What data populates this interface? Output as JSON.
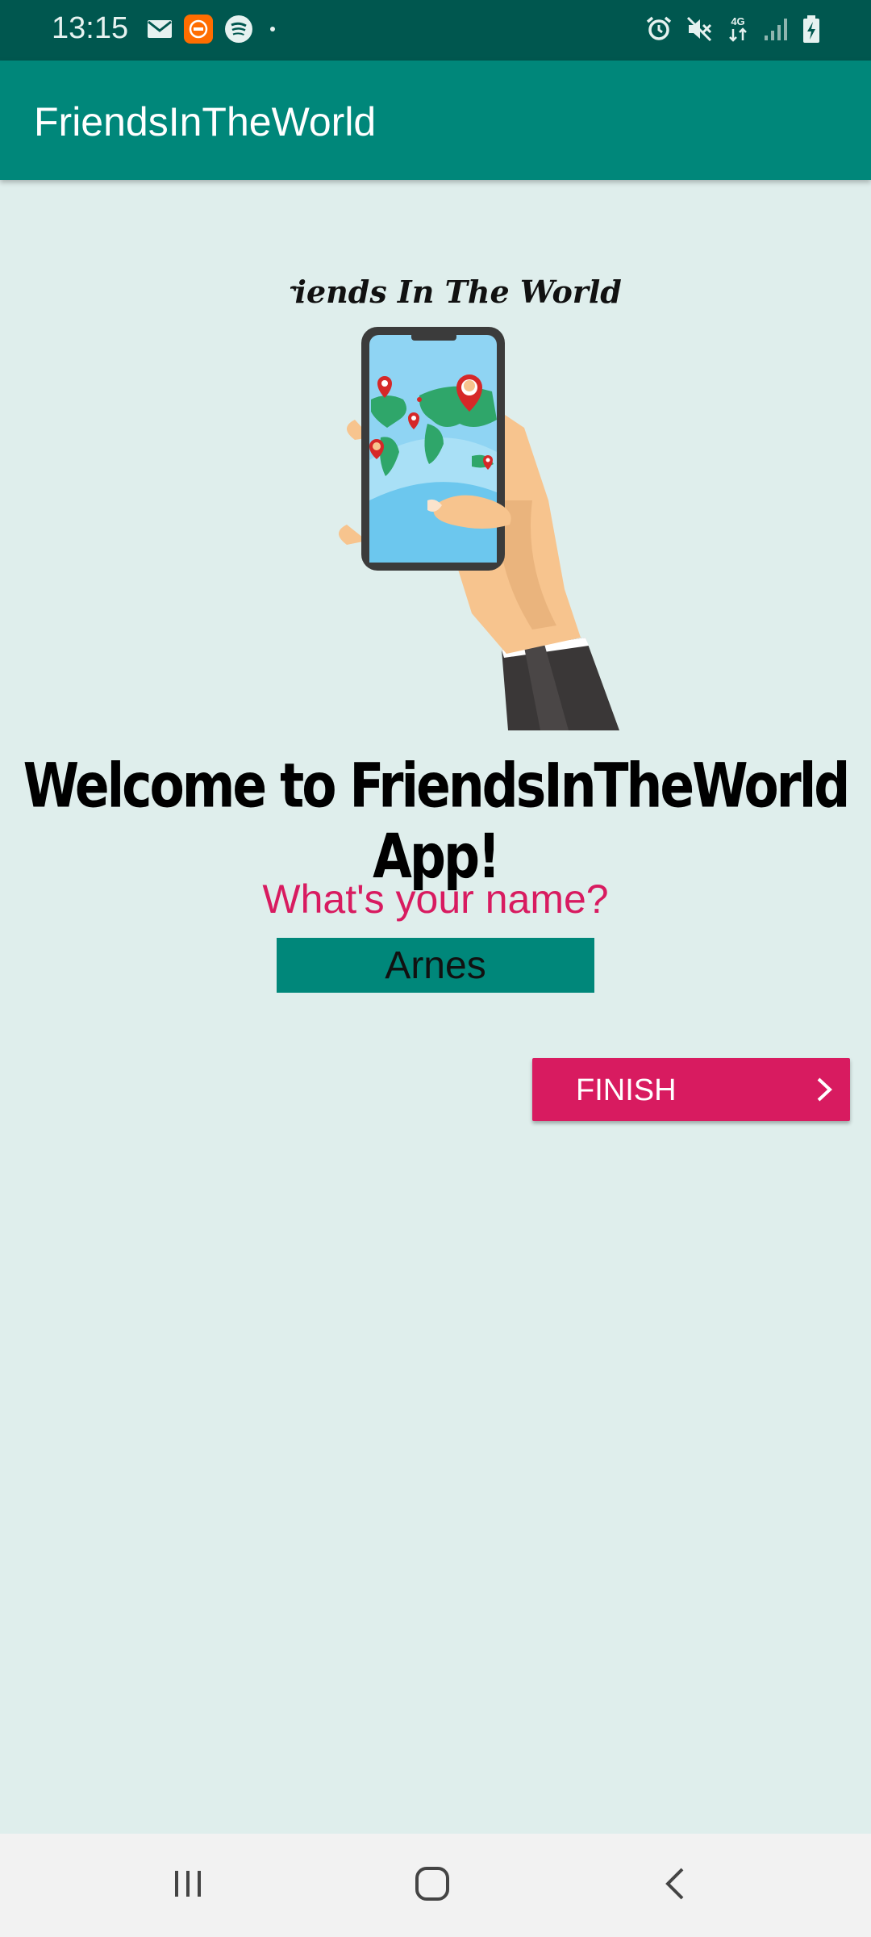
{
  "status_bar": {
    "time": "13:15",
    "left_icons": [
      "gmail-icon",
      "app-notification-icon",
      "spotify-icon",
      "dot-icon"
    ],
    "right_icons": [
      "alarm-icon",
      "mute-icon",
      "4g-icon",
      "signal-icon",
      "battery-charging-icon"
    ],
    "network_label": "4G"
  },
  "app_bar": {
    "title": "FriendsInTheWorld"
  },
  "hero": {
    "logo_text": "Friends In The World",
    "image_icon": "hand-holding-phone-with-world-map-illustration"
  },
  "main": {
    "welcome": "Welcome to FriendsInTheWorld App!",
    "prompt": "What's your name?",
    "name_value": "Arnes",
    "finish_label": "FINISH"
  },
  "nav_bar": {
    "icons": [
      "recents-icon",
      "home-icon",
      "back-icon"
    ]
  },
  "colors": {
    "status_bar": "#00574f",
    "app_bar": "#00877a",
    "background": "#dfeeec",
    "accent": "#d81b60",
    "name_field": "#00877a"
  }
}
